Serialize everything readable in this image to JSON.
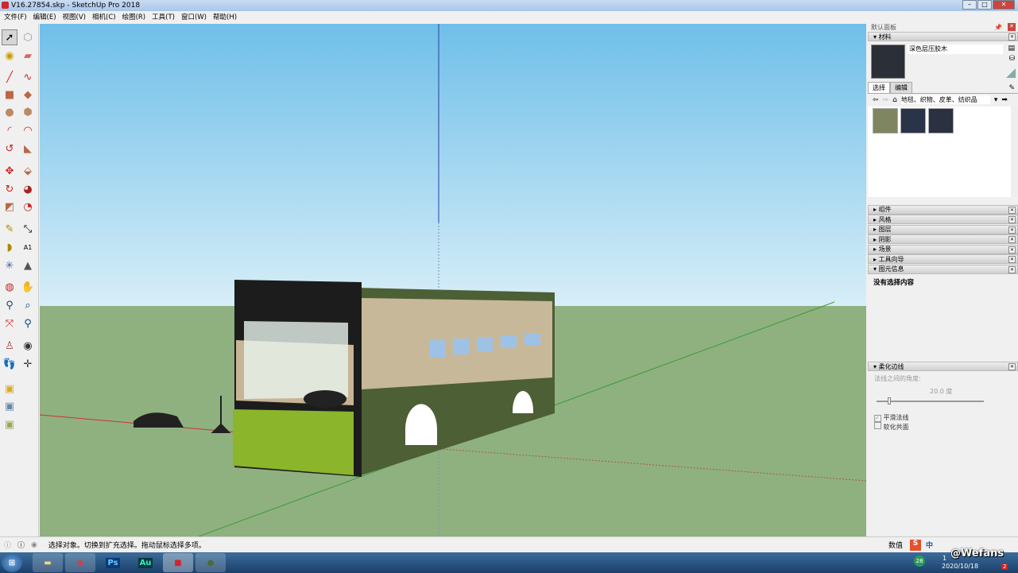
{
  "window": {
    "title": "V16.27854.skp - SketchUp Pro 2018"
  },
  "menu": [
    "文件(F)",
    "编辑(E)",
    "视图(V)",
    "相机(C)",
    "绘图(R)",
    "工具(T)",
    "窗口(W)",
    "帮助(H)"
  ],
  "panel": {
    "title": "默认面板",
    "materials": {
      "header": "材料",
      "name": "深色层压胶木",
      "tabs": [
        "选择",
        "编辑"
      ],
      "category": "地毯、织物、皮革、纺织品",
      "swatches": [
        "#7f8560",
        "#2a3448",
        "#2b3140"
      ]
    },
    "collapsed": [
      "组件",
      "风格",
      "图层",
      "阴影",
      "场景",
      "工具向导"
    ],
    "entity_info": {
      "header": "图元信息",
      "text": "没有选择内容"
    },
    "soften": {
      "header": "柔化边线",
      "angle_label": "法线之间的角度:",
      "angle_value": "20.0",
      "unit": "度",
      "slider_fraction": 0.1,
      "smooth_label": "平滑法线",
      "smooth_checked": true,
      "coplanar_label": "软化共面",
      "coplanar_checked": false
    }
  },
  "status": {
    "message": "选择对象。切换到扩充选择。拖动鼠标选择多项。",
    "measure_label": "数值"
  },
  "taskbar": {
    "apps": [
      "Ps",
      "Au"
    ],
    "badge": "28",
    "time": "1",
    "date": "2020/10/18",
    "notify": "2",
    "watermark": "@Wefans",
    "ime": "中"
  }
}
